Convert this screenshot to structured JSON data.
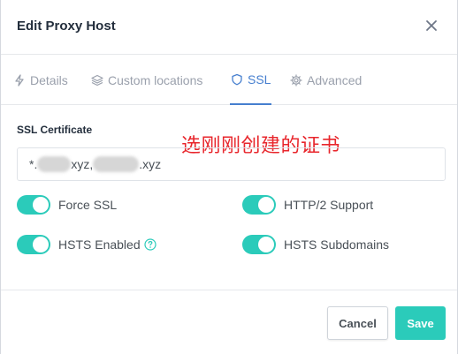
{
  "modal": {
    "title": "Edit Proxy Host",
    "close_icon": "close-icon"
  },
  "tabs": [
    {
      "label": "Details",
      "icon": "bolt-icon",
      "active": false
    },
    {
      "label": "Custom locations",
      "icon": "layers-icon",
      "active": false
    },
    {
      "label": "SSL",
      "icon": "shield-icon",
      "active": true
    },
    {
      "label": "Advanced",
      "icon": "gear-icon",
      "active": false
    }
  ],
  "ssl": {
    "certificate_label": "SSL Certificate",
    "annotation": "选刚刚创建的证书",
    "certificate_value": {
      "prefix": "*.",
      "part1_suffix": "xyz,",
      "part2_suffix": ".xyz"
    },
    "toggles": {
      "force_ssl": {
        "label": "Force SSL",
        "on": true
      },
      "http2": {
        "label": "HTTP/2 Support",
        "on": true
      },
      "hsts_enabled": {
        "label": "HSTS Enabled",
        "on": true
      },
      "hsts_subdomains": {
        "label": "HSTS Subdomains",
        "on": true
      }
    }
  },
  "footer": {
    "cancel_label": "Cancel",
    "save_label": "Save"
  },
  "colors": {
    "accent": "#467fcf",
    "toggle_on": "#2bcbba",
    "annotation": "#e8262c"
  }
}
